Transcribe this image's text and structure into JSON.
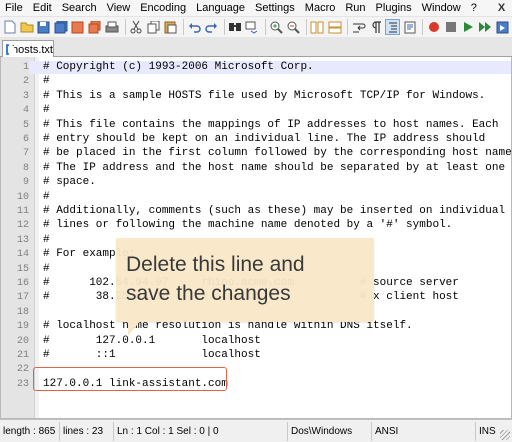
{
  "menu": {
    "items": [
      "File",
      "Edit",
      "Search",
      "View",
      "Encoding",
      "Language",
      "Settings",
      "Macro",
      "Run",
      "Plugins",
      "Window",
      "?"
    ],
    "close_glyph": "X"
  },
  "toolbar": {
    "icons": [
      "new-file-icon",
      "open-file-icon",
      "save-icon",
      "save-all-icon",
      "close-icon",
      "close-all-icon",
      "print-icon",
      "cut-icon",
      "copy-icon",
      "paste-icon",
      "undo-icon",
      "redo-icon",
      "find-icon",
      "replace-icon",
      "zoom-in-icon",
      "zoom-out-icon",
      "sync-v-icon",
      "sync-h-icon",
      "wrap-icon",
      "all-chars-icon",
      "indent-guide-icon",
      "doc-map-icon",
      "record-icon",
      "stop-icon",
      "play-icon",
      "play-multi-icon",
      "save-macro-icon"
    ]
  },
  "tab": {
    "label": "hosts.txt"
  },
  "editor": {
    "lines": [
      {
        "n": "1",
        "text": "# Copyright (c) 1993-2006 Microsoft Corp."
      },
      {
        "n": "2",
        "text": "#"
      },
      {
        "n": "3",
        "text": "# This is a sample HOSTS file used by Microsoft TCP/IP for Windows."
      },
      {
        "n": "4",
        "text": "#"
      },
      {
        "n": "5",
        "text": "# This file contains the mappings of IP addresses to host names. Each"
      },
      {
        "n": "6",
        "text": "# entry should be kept on an individual line. The IP address should"
      },
      {
        "n": "7",
        "text": "# be placed in the first column followed by the corresponding host name."
      },
      {
        "n": "8",
        "text": "# The IP address and the host name should be separated by at least one"
      },
      {
        "n": "9",
        "text": "# space."
      },
      {
        "n": "10",
        "text": "#"
      },
      {
        "n": "11",
        "text": "# Additionally, comments (such as these) may be inserted on individual"
      },
      {
        "n": "12",
        "text": "# lines or following the machine name denoted by a '#' symbol."
      },
      {
        "n": "13",
        "text": "#"
      },
      {
        "n": "14",
        "text": "# For example:"
      },
      {
        "n": "15",
        "text": "#"
      },
      {
        "n": "16",
        "text": "#      102.54.94.97     rhino.acme.com          # source server"
      },
      {
        "n": "17",
        "text": "#       38.25.63.10     x.acme.com              # x client host"
      },
      {
        "n": "18",
        "text": ""
      },
      {
        "n": "19",
        "text": "# localhost name resolution is handle within DNS itself."
      },
      {
        "n": "20",
        "text": "#       127.0.0.1       localhost"
      },
      {
        "n": "21",
        "text": "#       ::1             localhost"
      },
      {
        "n": "22",
        "text": ""
      },
      {
        "n": "23",
        "text": "127.0.0.1 link-assistant.com"
      }
    ]
  },
  "callout": {
    "text_line1": "Delete this line and",
    "text_line2": "save the changes"
  },
  "status": {
    "length": "length : 865",
    "lines": "lines : 23",
    "position": "Ln : 1    Col : 1    Sel : 0 | 0",
    "eol": "Dos\\Windows",
    "encoding": "ANSI",
    "mode": "INS"
  },
  "colors": {
    "highlight_border": "#e2624a",
    "callout_bg": "#f9e8c8",
    "current_line": "#e8e8ff"
  }
}
